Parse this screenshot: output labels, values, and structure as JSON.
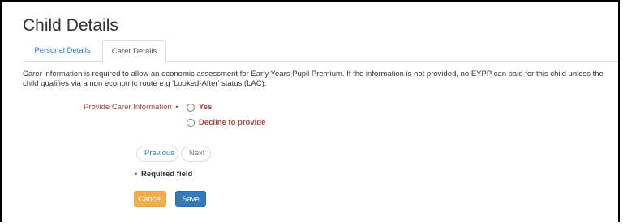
{
  "page": {
    "title": "Child Details"
  },
  "tabs": [
    {
      "label": "Personal Details"
    },
    {
      "label": "Carer Details"
    }
  ],
  "intro_text": "Carer information is required to allow an economic assessment for Early Years Pupil Premium. If the information is not provided, no EYPP can paid for this child unless the child qualifies via a non economic route e.g 'Looked-After' status (LAC).",
  "carer_info": {
    "label": "Provide Carer Information",
    "required_marker": "•",
    "options": [
      {
        "label": "Yes",
        "selected": false
      },
      {
        "label": "Decline to provide",
        "selected": false
      }
    ]
  },
  "pager": {
    "previous_label": "Previous",
    "next_label": "Next"
  },
  "required_note": {
    "marker": "•",
    "text": "Required field"
  },
  "actions": {
    "cancel_label": "Cancel",
    "save_label": "Save"
  },
  "colors": {
    "link": "#337ab7",
    "error_red": "#a94442",
    "cancel_orange": "#f0ad4e",
    "save_blue": "#337ab7"
  }
}
